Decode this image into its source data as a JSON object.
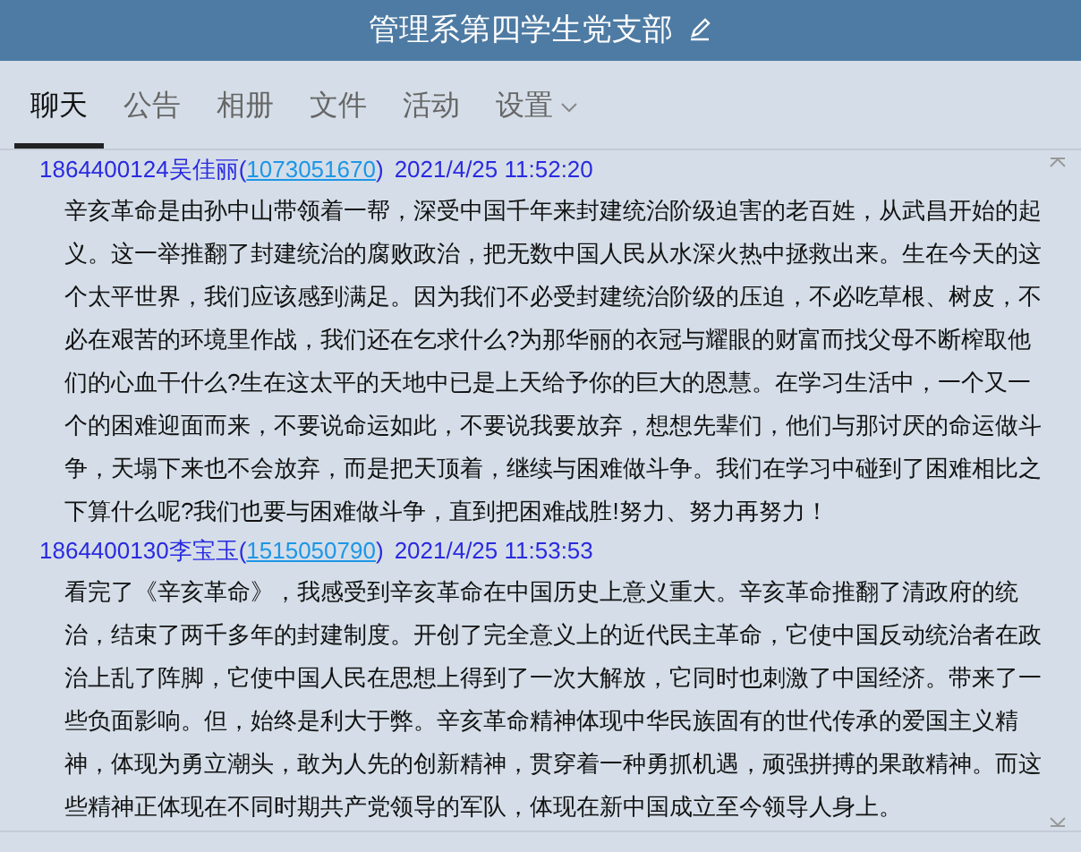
{
  "window": {
    "title": "管理系第四学生党支部"
  },
  "tabs": [
    {
      "label": "聊天",
      "selected": true,
      "kind": "plain"
    },
    {
      "label": "公告",
      "selected": false,
      "kind": "plain"
    },
    {
      "label": "相册",
      "selected": false,
      "kind": "plain"
    },
    {
      "label": "文件",
      "selected": false,
      "kind": "plain"
    },
    {
      "label": "活动",
      "selected": false,
      "kind": "plain"
    },
    {
      "label": "设置",
      "selected": false,
      "kind": "menu"
    }
  ],
  "messages": [
    {
      "sender": "1864400124吴佳丽",
      "open": "(",
      "account": "1073051670",
      "close": ")",
      "time": "2021/4/25 11:52:20",
      "text": "辛亥革命是由孙中山带领着一帮，深受中国千年来封建统治阶级迫害的老百姓，从武昌开始的起义。这一举推翻了封建统治的腐败政治，把无数中国人民从水深火热中拯救出来。生在今天的这个太平世界，我们应该感到满足。因为我们不必受封建统治阶级的压迫，不必吃草根、树皮，不必在艰苦的环境里作战，我们还在乞求什么?为那华丽的衣冠与耀眼的财富而找父母不断榨取他们的心血干什么?生在这太平的天地中已是上天给予你的巨大的恩慧。在学习生活中，一个又一个的困难迎面而来，不要说命运如此，不要说我要放弃，想想先辈们，他们与那讨厌的命运做斗争，天塌下来也不会放弃，而是把天顶着，继续与困难做斗争。我们在学习中碰到了困难相比之下算什么呢?我们也要与困难做斗争，直到把困难战胜!努力、努力再努力！"
    },
    {
      "sender": "1864400130李宝玉",
      "open": "(",
      "account": "1515050790",
      "close": ")",
      "time": "2021/4/25 11:53:53",
      "text": "看完了《辛亥革命》，我感受到辛亥革命在中国历史上意义重大。辛亥革命推翻了清政府的统治，结束了两千多年的封建制度。开创了完全意义上的近代民主革命，它使中国反动统治者在政治上乱了阵脚，它使中国人民在思想上得到了一次大解放，它同时也刺激了中国经济。带来了一些负面影响。但，始终是利大于弊。辛亥革命精神体现中华民族固有的世代传承的爱国主义精神，体现为勇立潮头，敢为人先的创新精神，贯穿着一种勇抓机遇，顽强拼搏的果敢精神。而这些精神正体现在不同时期共产党领导的军队，体现在新中国成立至今领导人身上。"
    }
  ]
}
